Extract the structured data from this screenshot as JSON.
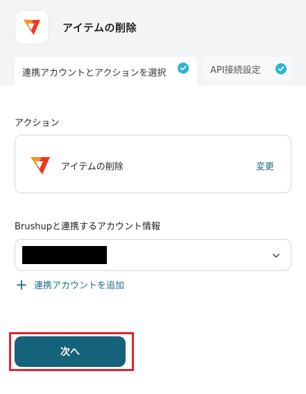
{
  "header": {
    "app_logo": "brushup-logo-icon",
    "title": "アイテムの削除",
    "tabs": [
      {
        "label": "連携アカウントとアクションを選択",
        "status": "completed",
        "active": true
      },
      {
        "label": "API接続設定",
        "status": "completed",
        "active": false
      }
    ]
  },
  "action_section": {
    "label": "アクション",
    "card": {
      "icon": "brushup-logo-icon",
      "action_name": "アイテムの削除",
      "change_label": "変更"
    }
  },
  "account_section": {
    "label": "Brushupと連携するアカウント情報",
    "selected_value": "",
    "add_account_label": "連携アカウントを追加"
  },
  "footer": {
    "next_button_label": "次へ"
  },
  "colors": {
    "accent": "#14637b",
    "link": "#1a6e86",
    "check": "#27b5d6",
    "highlight": "#e0232e",
    "brand_orange": "#f26a1b",
    "brand_red": "#d9241c"
  }
}
